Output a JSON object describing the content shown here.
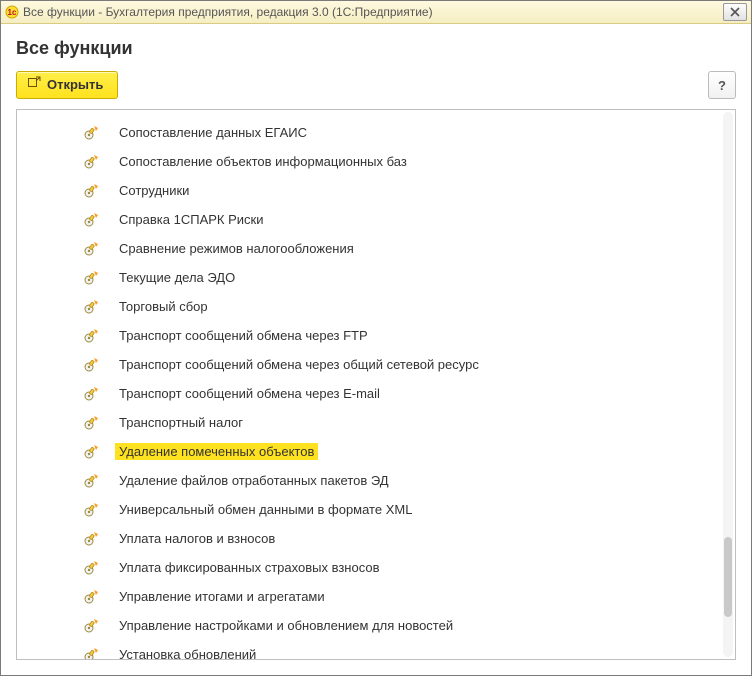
{
  "titlebar": {
    "logo_alt": "1c-logo",
    "text": "Все функции - Бухгалтерия предприятия, редакция 3.0  (1С:Предприятие)",
    "close_label": "×"
  },
  "page_title": "Все функции",
  "toolbar": {
    "open_label": "Открыть",
    "help_label": "?"
  },
  "tree": {
    "items": [
      {
        "label": "Сопоставление данных ЕГАИС"
      },
      {
        "label": "Сопоставление объектов информационных баз"
      },
      {
        "label": "Сотрудники"
      },
      {
        "label": "Справка 1СПАРК Риски"
      },
      {
        "label": "Сравнение режимов налогообложения"
      },
      {
        "label": "Текущие дела ЭДО"
      },
      {
        "label": "Торговый сбор"
      },
      {
        "label": "Транспорт сообщений обмена через FTP"
      },
      {
        "label": "Транспорт сообщений обмена через общий сетевой ресурс"
      },
      {
        "label": "Транспорт сообщений обмена через E-mail"
      },
      {
        "label": "Транспортный налог"
      },
      {
        "label": "Удаление помеченных объектов",
        "highlight": true
      },
      {
        "label": "Удаление файлов отработанных пакетов ЭД"
      },
      {
        "label": "Универсальный обмен данными в формате XML"
      },
      {
        "label": "Уплата налогов и взносов"
      },
      {
        "label": "Уплата фиксированных страховых взносов"
      },
      {
        "label": "Управление итогами и агрегатами"
      },
      {
        "label": "Управление настройками и обновлением для новостей"
      },
      {
        "label": "Установка обновлений"
      }
    ]
  }
}
